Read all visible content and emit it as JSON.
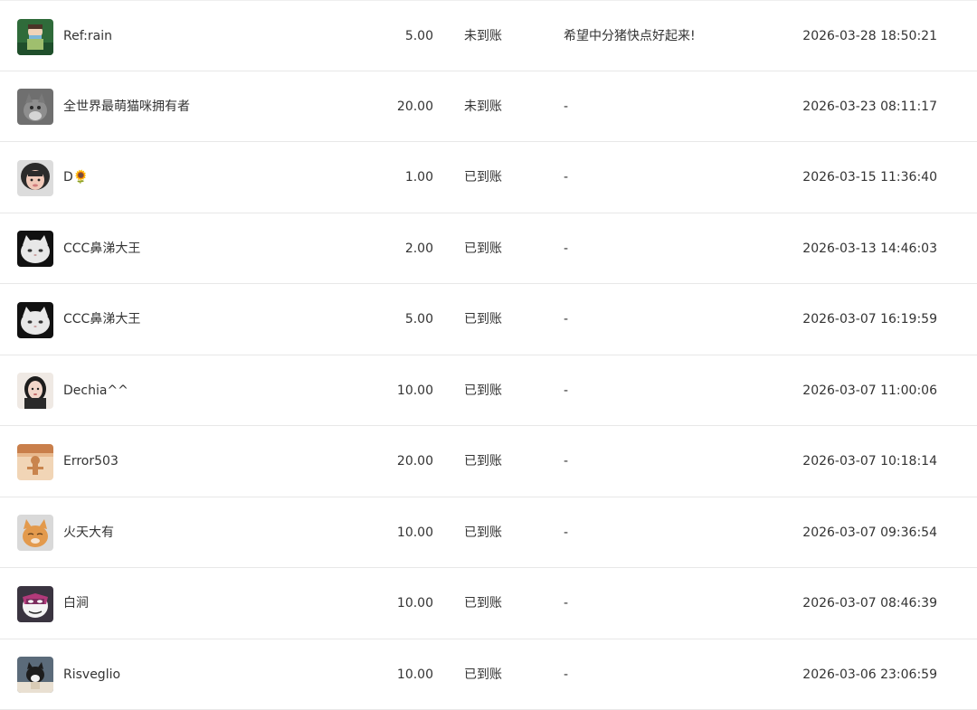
{
  "rows": [
    {
      "name": "Ref:rain",
      "amount": "5.00",
      "status": "未到账",
      "message": "希望中分猪快点好起来!",
      "time": "2026-03-28 18:50:21",
      "avatar": "green-bookish-avatar"
    },
    {
      "name": "全世界最萌猫咪拥有者",
      "amount": "20.00",
      "status": "未到账",
      "message": "-",
      "time": "2026-03-23 08:11:17",
      "avatar": "gray-cat-avatar"
    },
    {
      "name": "D🌻",
      "amount": "1.00",
      "status": "已到账",
      "message": "-",
      "time": "2026-03-15 11:36:40",
      "avatar": "girl-hood-avatar"
    },
    {
      "name": "CCC鼻涕大王",
      "amount": "2.00",
      "status": "已到账",
      "message": "-",
      "time": "2026-03-13 14:46:03",
      "avatar": "white-cat-avatar"
    },
    {
      "name": "CCC鼻涕大王",
      "amount": "5.00",
      "status": "已到账",
      "message": "-",
      "time": "2026-03-07 16:19:59",
      "avatar": "white-cat-avatar"
    },
    {
      "name": "Dechia^^",
      "amount": "10.00",
      "status": "已到账",
      "message": "-",
      "time": "2026-03-07 11:00:06",
      "avatar": "woman-portrait-avatar"
    },
    {
      "name": "Error503",
      "amount": "20.00",
      "status": "已到账",
      "message": "-",
      "time": "2026-03-07 10:18:14",
      "avatar": "orange-figure-avatar"
    },
    {
      "name": "火天大有",
      "amount": "10.00",
      "status": "已到账",
      "message": "-",
      "time": "2026-03-07 09:36:54",
      "avatar": "orange-cat-avatar"
    },
    {
      "name": "白涧",
      "amount": "10.00",
      "status": "已到账",
      "message": "-",
      "time": "2026-03-07 08:46:39",
      "avatar": "cartoon-mask-avatar"
    },
    {
      "name": "Risveglio",
      "amount": "10.00",
      "status": "已到账",
      "message": "-",
      "time": "2026-03-06 23:06:59",
      "avatar": "black-white-cat-avatar"
    }
  ],
  "colors": {
    "text": "#333333",
    "divider": "#e8e8e8",
    "background": "#ffffff"
  }
}
